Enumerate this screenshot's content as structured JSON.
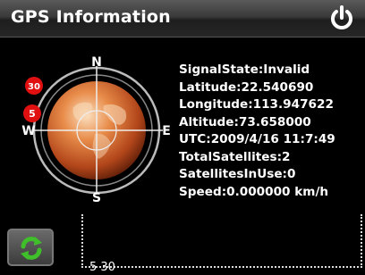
{
  "header": {
    "title": "GPS Information",
    "power_icon": "power-icon"
  },
  "compass": {
    "directions": {
      "north": "N",
      "east": "E",
      "south": "S",
      "west": "W"
    },
    "satellites": [
      "30",
      "5"
    ],
    "satellite_color": "#e01010",
    "globe_color": "#d8703a"
  },
  "info": {
    "signal_state": "SignalState:Invalid",
    "latitude": "Latitude:22.540690",
    "longitude": "Longitude:113.947622",
    "altitude": "Altitude:73.658000",
    "utc": "UTC:2009/4/16 11:7:49",
    "total_satellites": "TotalSatellites:2",
    "satellites_in_use": "SatellitesInUse:0",
    "speed": "Speed:0.000000 km/h"
  },
  "toolbar": {
    "refresh_icon": "refresh-icon",
    "accent": "#3fbf2a"
  },
  "signal_chart": {
    "label": "5 30"
  }
}
